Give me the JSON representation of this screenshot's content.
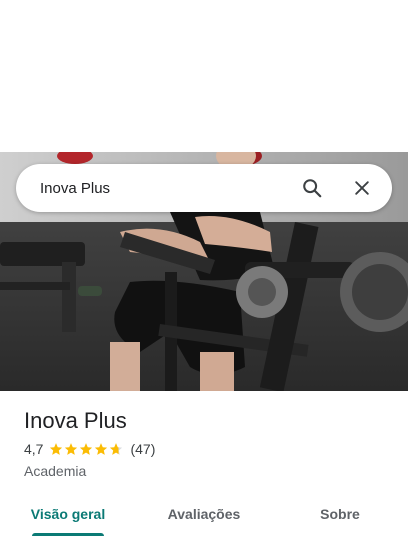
{
  "search": {
    "query": "Inova Plus"
  },
  "place": {
    "title": "Inova Plus",
    "rating": "4,7",
    "rating_value": 4.7,
    "reviews_count": "(47)",
    "category": "Academia"
  },
  "tabs": [
    {
      "label": "Visão geral",
      "active": true
    },
    {
      "label": "Avaliações",
      "active": false
    },
    {
      "label": "Sobre",
      "active": false
    }
  ],
  "colors": {
    "accent": "#0b7a75",
    "star": "#fbbc04",
    "title": "#202124"
  },
  "icons": {
    "search": "search-icon",
    "close": "close-icon",
    "star": "star-icon"
  }
}
